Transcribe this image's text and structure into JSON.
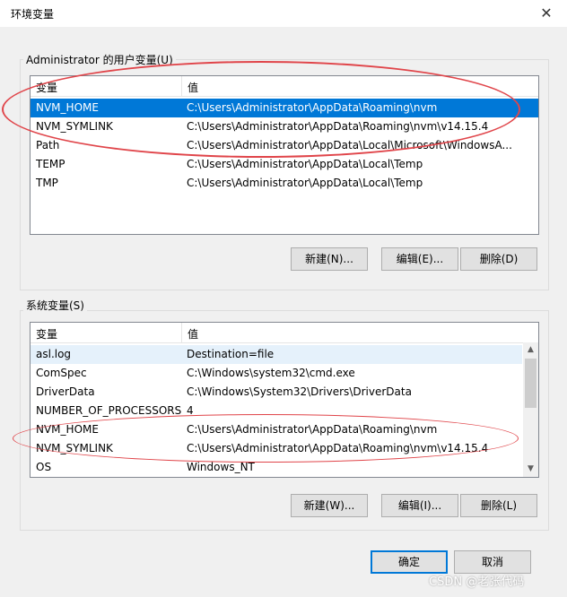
{
  "window": {
    "title": "环境变量",
    "close_glyph": "✕"
  },
  "user_vars": {
    "legend": "Administrator 的用户变量(U)",
    "columns": {
      "name": "变量",
      "value": "值"
    },
    "rows": [
      {
        "name": "NVM_HOME",
        "value": "C:\\Users\\Administrator\\AppData\\Roaming\\nvm",
        "selected": true
      },
      {
        "name": "NVM_SYMLINK",
        "value": "C:\\Users\\Administrator\\AppData\\Roaming\\nvm\\v14.15.4"
      },
      {
        "name": "Path",
        "value": "C:\\Users\\Administrator\\AppData\\Local\\Microsoft\\WindowsA..."
      },
      {
        "name": "TEMP",
        "value": "C:\\Users\\Administrator\\AppData\\Local\\Temp"
      },
      {
        "name": "TMP",
        "value": "C:\\Users\\Administrator\\AppData\\Local\\Temp"
      }
    ],
    "buttons": {
      "new": "新建(N)...",
      "edit": "编辑(E)...",
      "delete": "删除(D)"
    }
  },
  "system_vars": {
    "legend": "系统变量(S)",
    "columns": {
      "name": "变量",
      "value": "值"
    },
    "rows": [
      {
        "name": "asl.log",
        "value": "Destination=file",
        "highlight": true
      },
      {
        "name": "ComSpec",
        "value": "C:\\Windows\\system32\\cmd.exe"
      },
      {
        "name": "DriverData",
        "value": "C:\\Windows\\System32\\Drivers\\DriverData"
      },
      {
        "name": "NUMBER_OF_PROCESSORS",
        "value": "4"
      },
      {
        "name": "NVM_HOME",
        "value": "C:\\Users\\Administrator\\AppData\\Roaming\\nvm"
      },
      {
        "name": "NVM_SYMLINK",
        "value": "C:\\Users\\Administrator\\AppData\\Roaming\\nvm\\v14.15.4"
      },
      {
        "name": "OS",
        "value": "Windows_NT"
      }
    ],
    "buttons": {
      "new": "新建(W)...",
      "edit": "编辑(I)...",
      "delete": "删除(L)"
    }
  },
  "footer": {
    "ok": "确定",
    "cancel": "取消"
  },
  "watermark": "CSDN @老张代码",
  "colors": {
    "selection": "#0078d7",
    "annotation": "#e0454a"
  }
}
